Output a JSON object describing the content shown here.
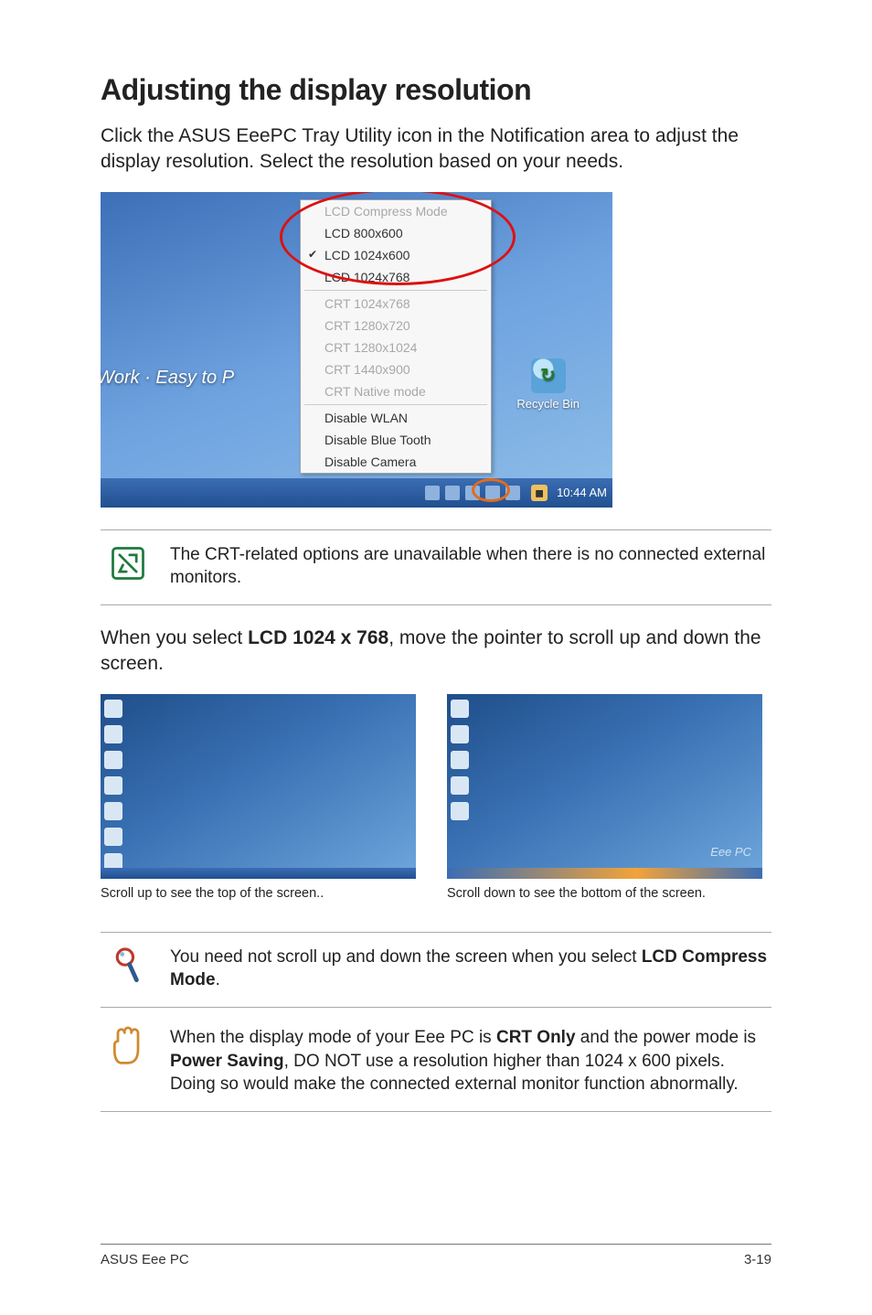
{
  "heading": "Adjusting the display resolution",
  "intro": "Click the ASUS EeePC Tray Utility icon in the Notification area to adjust the display resolution. Select the resolution based on your needs.",
  "menu": {
    "items": [
      {
        "label": "LCD Compress Mode",
        "disabled": true
      },
      {
        "label": "LCD 800x600"
      },
      {
        "label": "LCD 1024x600",
        "checked": true
      },
      {
        "label": "LCD 1024x768"
      }
    ],
    "crt_items": [
      "CRT 1024x768",
      "CRT 1280x720",
      "CRT 1280x1024",
      "CRT 1440x900",
      "CRT Native mode"
    ],
    "disable_items": [
      "Disable WLAN",
      "Disable Blue Tooth",
      "Disable Camera"
    ]
  },
  "desktop": {
    "recycle_label": "Recycle Bin",
    "side_label": "Work · Easy to P",
    "clock": "10:44 AM"
  },
  "note1": "The CRT-related options are unavailable when there is no connected external monitors.",
  "mid_para_prefix": "When you select ",
  "mid_para_bold": "LCD 1024 x 768",
  "mid_para_suffix": ", move the pointer to scroll up and down the screen.",
  "shot_watermark": "Eee PC",
  "caption_left": "Scroll up to see the top of the screen..",
  "caption_right": "Scroll down to see the bottom of the screen.",
  "tip_prefix": "You need not scroll up and down the screen when you select ",
  "tip_bold": "LCD Compress Mode",
  "tip_suffix": ".",
  "caution_a": "When the display mode of your Eee PC is ",
  "caution_bold1": "CRT Only",
  "caution_b": " and the power mode is ",
  "caution_bold2": "Power Saving",
  "caution_c": ", DO NOT use a resolution higher than 1024 x 600 pixels. Doing so would make the connected external monitor function abnormally.",
  "footer_left": "ASUS Eee PC",
  "footer_right": "3-19"
}
